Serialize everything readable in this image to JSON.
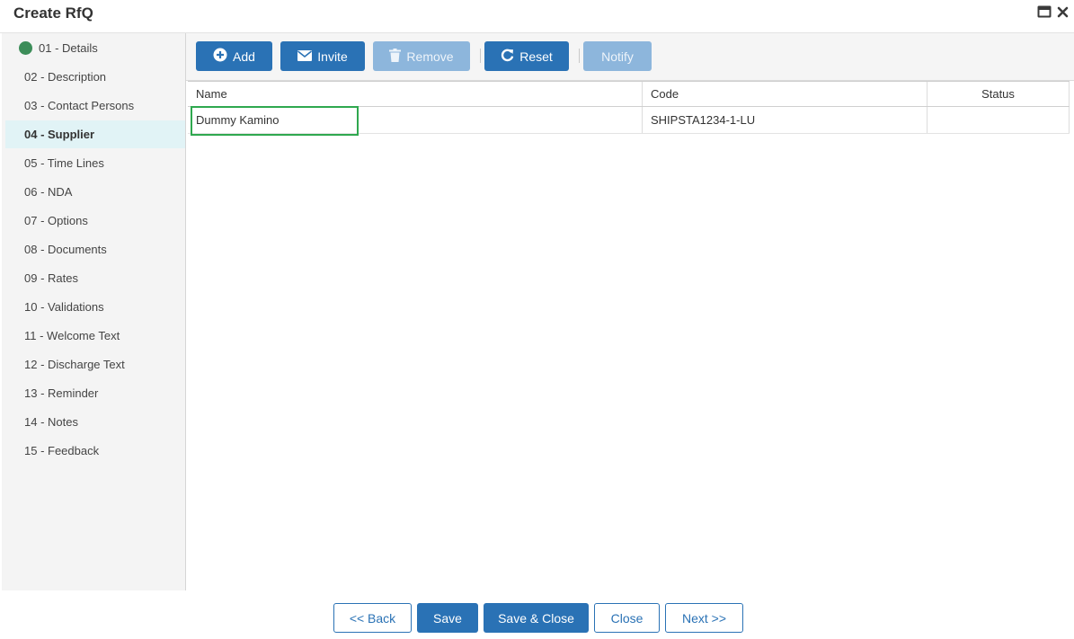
{
  "window": {
    "title": "Create RfQ",
    "icons": [
      "window-restore-icon",
      "close-icon"
    ]
  },
  "sidebar": {
    "items": [
      {
        "label": "01 - Details",
        "status": "complete"
      },
      {
        "label": "02 - Description"
      },
      {
        "label": "03 - Contact Persons"
      },
      {
        "label": "04 - Supplier",
        "active": true
      },
      {
        "label": "05 - Time Lines"
      },
      {
        "label": "06 - NDA"
      },
      {
        "label": "07 - Options"
      },
      {
        "label": "08 - Documents"
      },
      {
        "label": "09 - Rates"
      },
      {
        "label": "10 - Validations"
      },
      {
        "label": "11 - Welcome Text"
      },
      {
        "label": "12 - Discharge Text"
      },
      {
        "label": "13 - Reminder"
      },
      {
        "label": "14 - Notes"
      },
      {
        "label": "15 - Feedback"
      }
    ]
  },
  "toolbar": {
    "add_label": "Add",
    "invite_label": "Invite",
    "remove_label": "Remove",
    "reset_label": "Reset",
    "notify_label": "Notify"
  },
  "grid": {
    "columns": [
      "Name",
      "Code",
      "Status"
    ],
    "rows": [
      {
        "name": "Dummy Kamino",
        "code": "SHIPSTA1234-1-LU",
        "status": ""
      }
    ]
  },
  "footer": {
    "back_label": "<< Back",
    "save_label": "Save",
    "save_close_label": "Save & Close",
    "close_label": "Close",
    "next_label": "Next >>"
  },
  "colors": {
    "primary": "#2a72b5",
    "primary_disabled": "#8db6dc",
    "active_step_bg": "#e1f3f6",
    "complete_dot": "#3c8d59",
    "highlight_border": "#2fa84f"
  }
}
